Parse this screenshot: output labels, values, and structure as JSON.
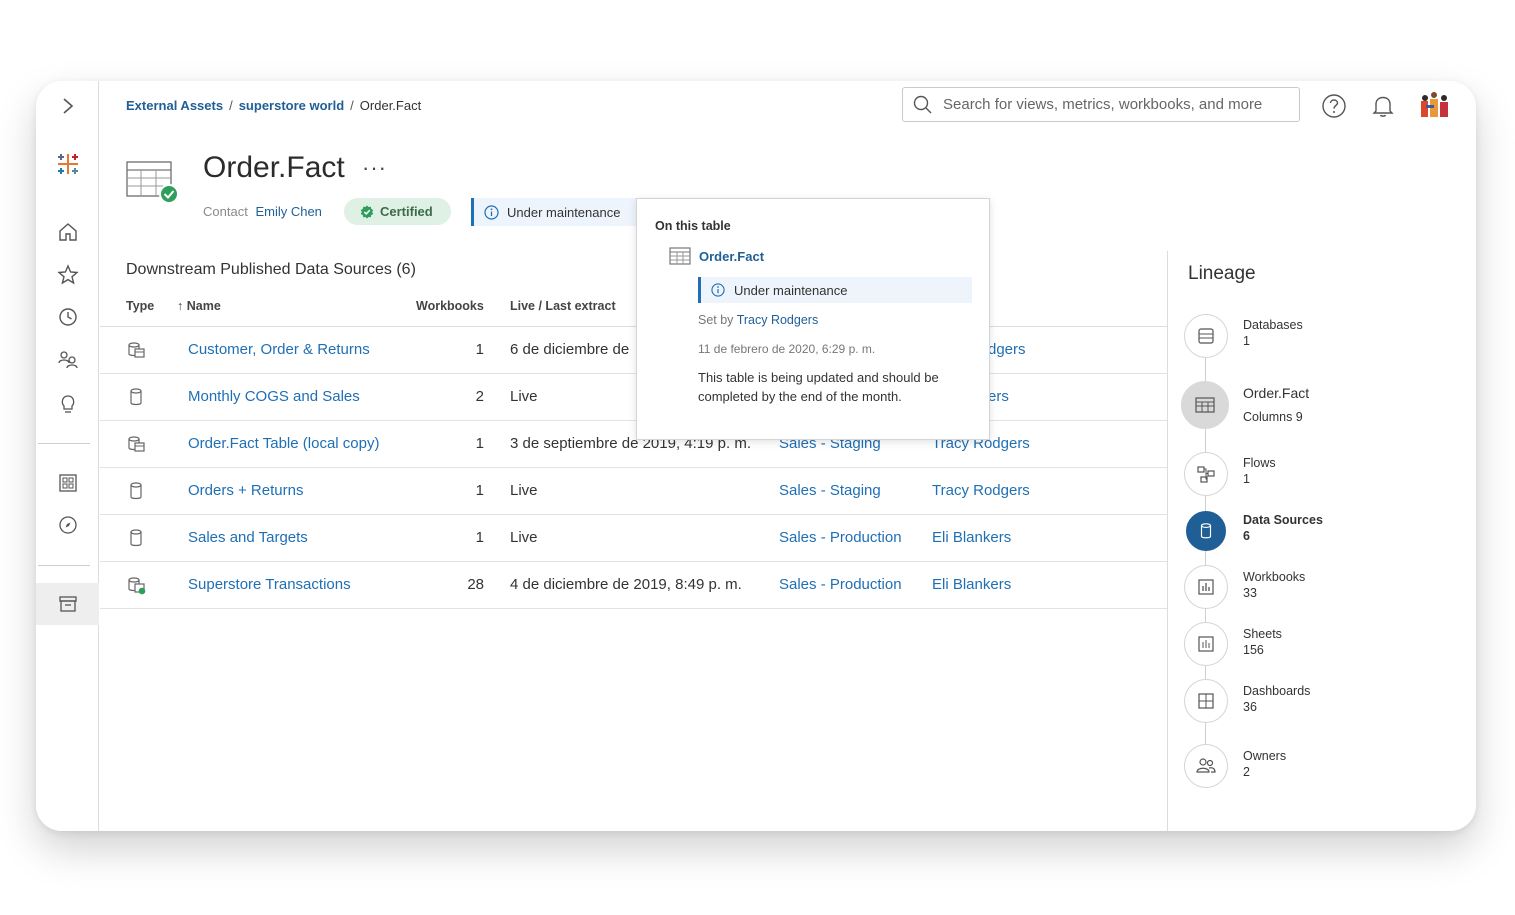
{
  "breadcrumb": [
    "External Assets",
    "superstore world",
    "Order.Fact"
  ],
  "search": {
    "placeholder": "Search for views, metrics, workbooks, and more"
  },
  "asset": {
    "title": "Order.Fact",
    "more": "···",
    "contact_label": "Contact",
    "contact_name": "Emily Chen",
    "certified_label": "Certified",
    "maintenance_label": "Under maintenance"
  },
  "table": {
    "title": "Downstream Published Data Sources (6)",
    "columns": {
      "type": "Type",
      "name": "↑ Name",
      "workbooks": "Workbooks",
      "extract": "Live / Last extract"
    },
    "rows": [
      {
        "name": "Customer, Order & Returns",
        "workbooks": "1",
        "extract": "6 de diciembre de",
        "project": "",
        "owner": "dgers"
      },
      {
        "name": "Monthly COGS and Sales",
        "workbooks": "2",
        "extract": "Live",
        "project": "",
        "owner": "ers"
      },
      {
        "name": "Order.Fact Table (local copy)",
        "workbooks": "1",
        "extract": "3 de septiembre de 2019, 4:19 p. m.",
        "project": "Sales - Staging",
        "owner": "Tracy Rodgers"
      },
      {
        "name": "Orders + Returns",
        "workbooks": "1",
        "extract": "Live",
        "project": "Sales - Staging",
        "owner": "Tracy Rodgers"
      },
      {
        "name": "Sales and Targets",
        "workbooks": "1",
        "extract": "Live",
        "project": "Sales - Production",
        "owner": "Eli Blankers"
      },
      {
        "name": "Superstore Transactions",
        "workbooks": "28",
        "extract": "4 de diciembre de 2019, 8:49 p. m.",
        "project": "Sales - Production",
        "owner": "Eli Blankers"
      }
    ]
  },
  "popover": {
    "heading": "On this table",
    "table_name": "Order.Fact",
    "status": "Under maintenance",
    "set_by_label": "Set by",
    "set_by_name": "Tracy Rodgers",
    "date": "11 de febrero de 2020, 6:29 p. m.",
    "description": "This table is being updated and should be completed by the end of the month."
  },
  "lineage": {
    "title": "Lineage",
    "nodes": [
      {
        "label": "Databases",
        "count": "1",
        "icon": "database-icon"
      },
      {
        "label": "Order.Fact",
        "count": "Columns 9",
        "icon": "table-icon"
      },
      {
        "label": "Flows",
        "count": "1",
        "icon": "flow-icon"
      },
      {
        "label": "Data Sources",
        "count": "6",
        "icon": "datasource-icon"
      },
      {
        "label": "Workbooks",
        "count": "33",
        "icon": "workbook-icon"
      },
      {
        "label": "Sheets",
        "count": "156",
        "icon": "sheet-icon"
      },
      {
        "label": "Dashboards",
        "count": "36",
        "icon": "dashboard-icon"
      },
      {
        "label": "Owners",
        "count": "2",
        "icon": "owners-icon"
      }
    ]
  },
  "colors": {
    "link": "#1f6fb5",
    "brand_blue": "#1f5f96",
    "certified_bg": "#dff0e4",
    "certified_icon": "#2e9e5b"
  }
}
